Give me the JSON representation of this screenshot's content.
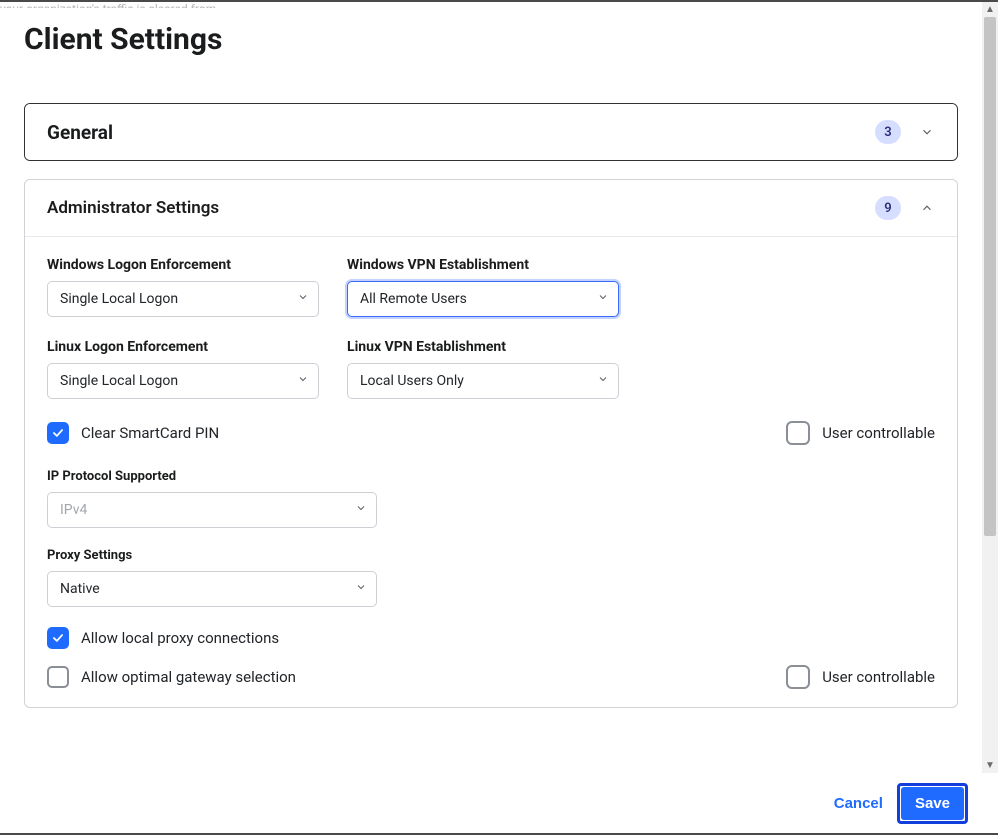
{
  "strip_text": "your organization's traffic is cleared from",
  "page_title": "Client Settings",
  "sections": {
    "general": {
      "title": "General",
      "badge": "3"
    },
    "admin": {
      "title": "Administrator Settings",
      "badge": "9"
    }
  },
  "fields": {
    "win_logon_label": "Windows Logon Enforcement",
    "win_logon_value": "Single Local Logon",
    "win_vpn_label": "Windows VPN Establishment",
    "win_vpn_value": "All Remote Users",
    "lin_logon_label": "Linux Logon Enforcement",
    "lin_logon_value": "Single Local Logon",
    "lin_vpn_label": "Linux VPN Establishment",
    "lin_vpn_value": "Local Users Only",
    "ip_proto_label": "IP Protocol Supported",
    "ip_proto_value": "IPv4",
    "proxy_label": "Proxy Settings",
    "proxy_value": "Native"
  },
  "checks": {
    "clear_pin": "Clear SmartCard PIN",
    "user_controllable": "User controllable",
    "allow_local_proxy": "Allow local proxy connections",
    "allow_optimal_gw": "Allow optimal gateway selection"
  },
  "footer": {
    "cancel": "Cancel",
    "save": "Save"
  }
}
